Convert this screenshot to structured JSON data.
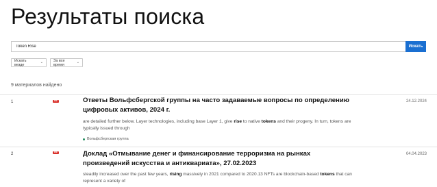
{
  "page": {
    "title": "Результаты поиска"
  },
  "search": {
    "value": "Token Rise",
    "button_label": "Искать"
  },
  "filters": [
    {
      "label": "Искать везде"
    },
    {
      "label": "За все время"
    }
  ],
  "results_count": "9 материалов найдено",
  "results": [
    {
      "number": "1",
      "badge": "PDF",
      "title": "Ответы Вольфсбергской группы на часто задаваемые вопросы по определению цифровых активов, 2024 г.",
      "date": "24.12.2024",
      "snippet_parts": [
        "are detailed further below. Layer technologies, including base Layer 1, give ",
        "rise",
        " to native ",
        "tokens",
        " and their progeny. In turn, tokens are typically issued through"
      ],
      "source": "Вольфсбергская группа"
    },
    {
      "number": "2",
      "badge": "PDF",
      "title": "Доклад «Отмывание денег и финансирование терроризма на рынках произведений искусства и антиквариата», 27.02.2023",
      "date": "04.04.2023",
      "snippet_parts": [
        "steadily increased over the past few years, ",
        "rising",
        " massively in 2021 compared to 2020.13 NFTs are blockchain-based ",
        "tokens",
        " that can represent a variety of"
      ]
    }
  ],
  "colors": {
    "accent": "#1a6fd1",
    "pdf_badge": "#d9312b",
    "source_dot": "#1f8a5b"
  }
}
